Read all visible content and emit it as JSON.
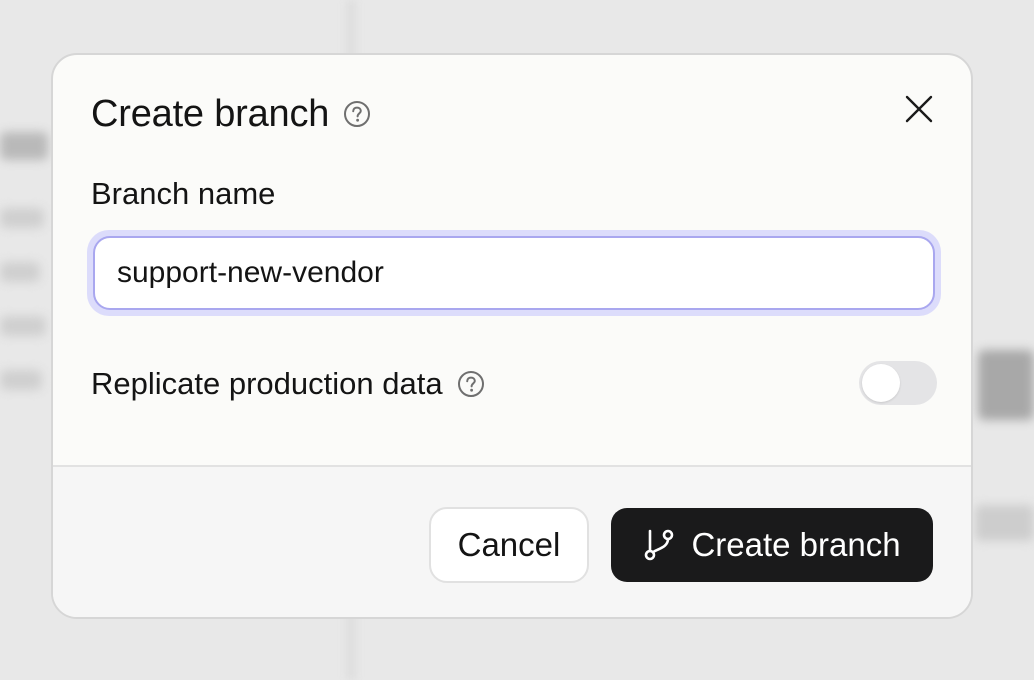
{
  "dialog": {
    "title": "Create branch",
    "close_label": "Close"
  },
  "branch_name": {
    "label": "Branch name",
    "value": "support-new-vendor"
  },
  "replicate": {
    "label": "Replicate production data",
    "enabled": false
  },
  "actions": {
    "cancel_label": "Cancel",
    "create_label": "Create branch"
  },
  "colors": {
    "primary_button": "#1a1a1b",
    "input_focus_ring": "#dcdcfb",
    "input_focus_border": "#a9a7ef",
    "toggle_off": "#e4e4e6"
  },
  "icons": {
    "help": "help-circle-icon",
    "close": "close-icon",
    "branch": "git-branch-icon"
  }
}
